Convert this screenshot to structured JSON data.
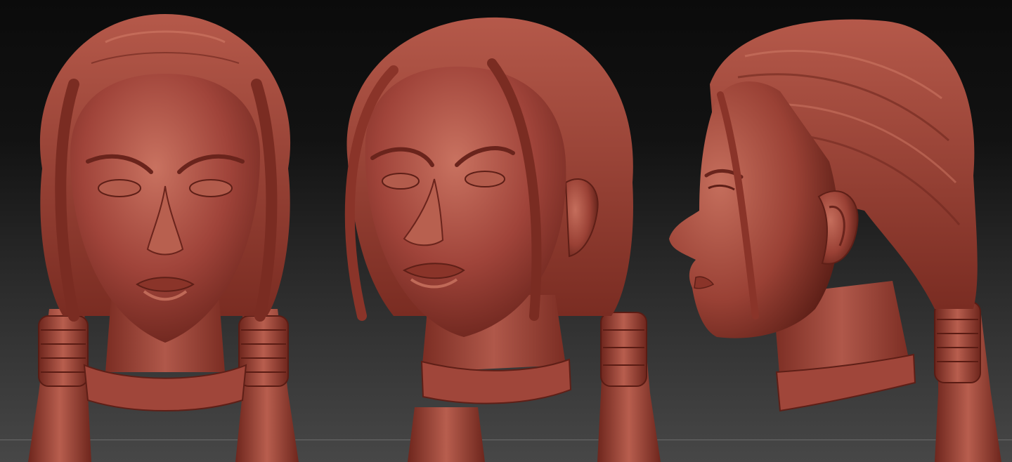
{
  "scene": {
    "subject": "sculpted-head-turnaround",
    "views": [
      "front",
      "three-quarter",
      "profile"
    ],
    "colors": {
      "clay_base": "#9c3f31",
      "clay_light": "#c76a58",
      "clay_dark": "#5e1f17",
      "background_top": "#0b0b0b",
      "background_bottom": "#474747"
    }
  }
}
